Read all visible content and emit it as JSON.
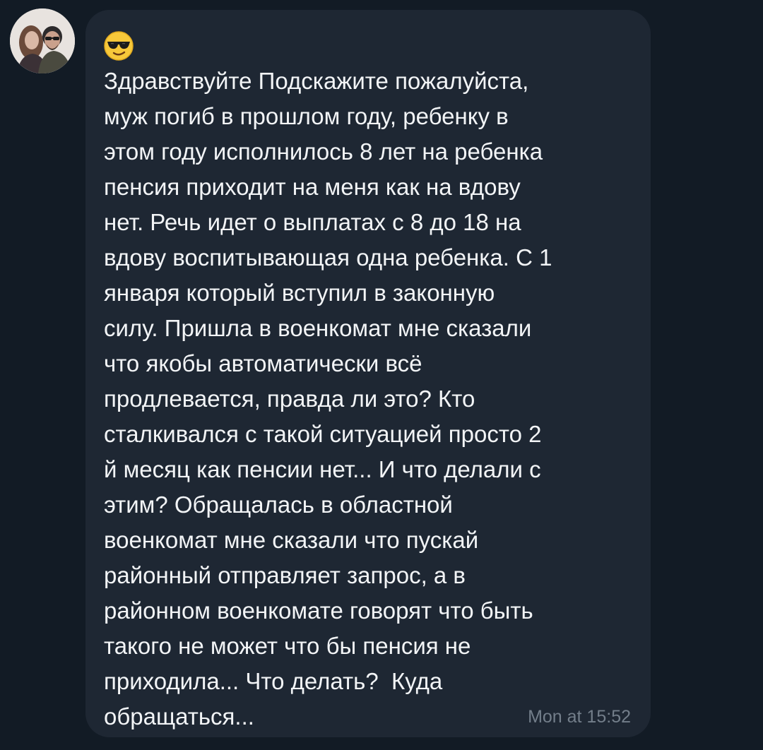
{
  "message": {
    "sender_avatar": "avatar-photo",
    "emoji": "😎",
    "text_lines": [
      "Здравствуйте Подскажите пожалуйста,",
      "муж погиб в прошлом году, ребенку в",
      "этом году исполнилось 8 лет на ребенка",
      "пенсия приходит на меня как на вдову",
      "нет. Речь идет о выплатах с 8 до 18 на",
      "вдову воспитывающая одна ребенка. С 1",
      "января который вступил в законную",
      "силу. Пришла в военкомат мне сказали",
      "что якобы автоматически всё",
      "продлевается, правда ли это? Кто",
      "сталкивался с такой ситуацией просто 2",
      "й месяц как пенсии нет... И что делали с",
      "этим? Обращалась в областной",
      "военкомат мне сказали что пускай",
      "районный отправляет запрос, а в",
      "районном военкомате говорят что быть",
      "такого не может что бы пенсия не",
      "приходила... Что делать?  Куда",
      "обращаться..."
    ],
    "timestamp": "Mon at 15:52"
  },
  "colors": {
    "background": "#121b25",
    "bubble": "#1e2733",
    "text": "#f2f4f6",
    "timestamp": "#737e8a"
  }
}
